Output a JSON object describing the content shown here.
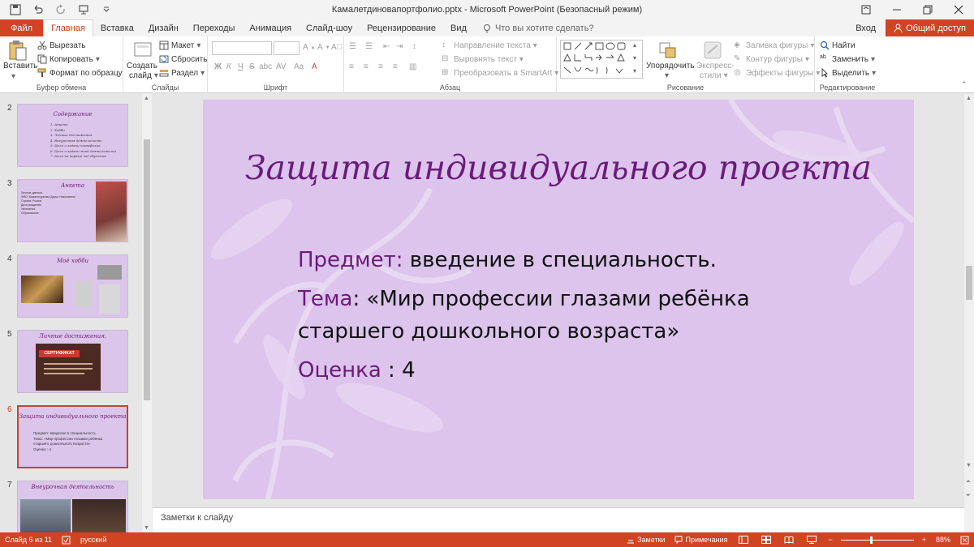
{
  "window": {
    "title": "Камалетдиновапортфолио.pptx - Microsoft PowerPoint (Безопасный режим)"
  },
  "tabs": [
    "Файл",
    "Главная",
    "Вставка",
    "Дизайн",
    "Переходы",
    "Анимация",
    "Слайд-шоу",
    "Рецензирование",
    "Вид"
  ],
  "tell_me": "Что вы хотите сделать?",
  "signin": "Вход",
  "share": "Общий доступ",
  "ribbon": {
    "clipboard": {
      "paste": "Вставить",
      "cut": "Вырезать",
      "copy": "Копировать",
      "format_painter": "Формат по образцу",
      "label": "Буфер обмена"
    },
    "slides": {
      "new_slide_1": "Создать",
      "new_slide_2": "слайд",
      "layout": "Макет",
      "reset": "Сбросить",
      "section": "Раздел",
      "label": "Слайды"
    },
    "font": {
      "label": "Шрифт",
      "bold": "Ж",
      "italic": "К",
      "underline": "Ч",
      "strike": "S",
      "shadow": "abc",
      "spacing": "AV",
      "case": "Aa",
      "color": "A"
    },
    "paragraph": {
      "text_direction": "Направление текста",
      "align_text": "Выровнять текст",
      "smartart": "Преобразовать в SmartArt",
      "label": "Абзац"
    },
    "drawing": {
      "arrange": "Упорядочить",
      "quick_styles_1": "Экспресс-",
      "quick_styles_2": "стили",
      "shape_fill": "Заливка фигуры",
      "shape_outline": "Контур фигуры",
      "shape_effects": "Эффекты фигуры",
      "label": "Рисование"
    },
    "editing": {
      "find": "Найти",
      "replace": "Заменить",
      "select": "Выделить",
      "label": "Редактирование"
    }
  },
  "thumbnails": [
    {
      "num": "2",
      "title": "Содержание",
      "lines": [
        "1. Анкета",
        "2. Хобби",
        "3. Личные достижения",
        "4. Внеурочная деятельность",
        "5. Цели и задачи портфолио",
        "6. Цели и задачи моей деятельности",
        "7. Цели на первый год обучения"
      ]
    },
    {
      "num": "3",
      "title": "Анкета",
      "lines": [
        "Личные данные:",
        "ФИО: Камалетдинова Дарья Николаевна",
        "Страна: Россия",
        "Дата рождения",
        "Увлечения",
        "Образование"
      ]
    },
    {
      "num": "4",
      "title": "Моё хобби",
      "lines": []
    },
    {
      "num": "5",
      "title": "Личные достижения.",
      "lines": [],
      "cert": "СЕРТИФИКАТ"
    },
    {
      "num": "6",
      "title": "Защита индивидуального проекта",
      "lines": [
        "Предмет: введение в специальность.",
        "Тема: «Мир профессии глазами ребёнка",
        "старшего дошкольного возраста»",
        "Оценка : 4"
      ]
    },
    {
      "num": "7",
      "title": "Внеурочная деятельность",
      "lines": []
    }
  ],
  "slide": {
    "title": "Защита индивидуального проекта",
    "subject_label": "Предмет:",
    "subject_value": " введение в специальность.",
    "topic_label": "Тема",
    "topic_value_1": ": «Мир профессии глазами ребёнка",
    "topic_value_2": "старшего дошкольного возраста»",
    "grade_label": "Оценка",
    "grade_value": " : 4"
  },
  "notes_placeholder": "Заметки к слайду",
  "status": {
    "slide_counter": "Слайд 6 из 11",
    "language": "русский",
    "notes": "Заметки",
    "comments": "Примечания",
    "zoom": "88%"
  },
  "colors": {
    "accent": "#d04423",
    "slide_bg": "#dcc4ec",
    "title_color": "#6b1a7a"
  }
}
